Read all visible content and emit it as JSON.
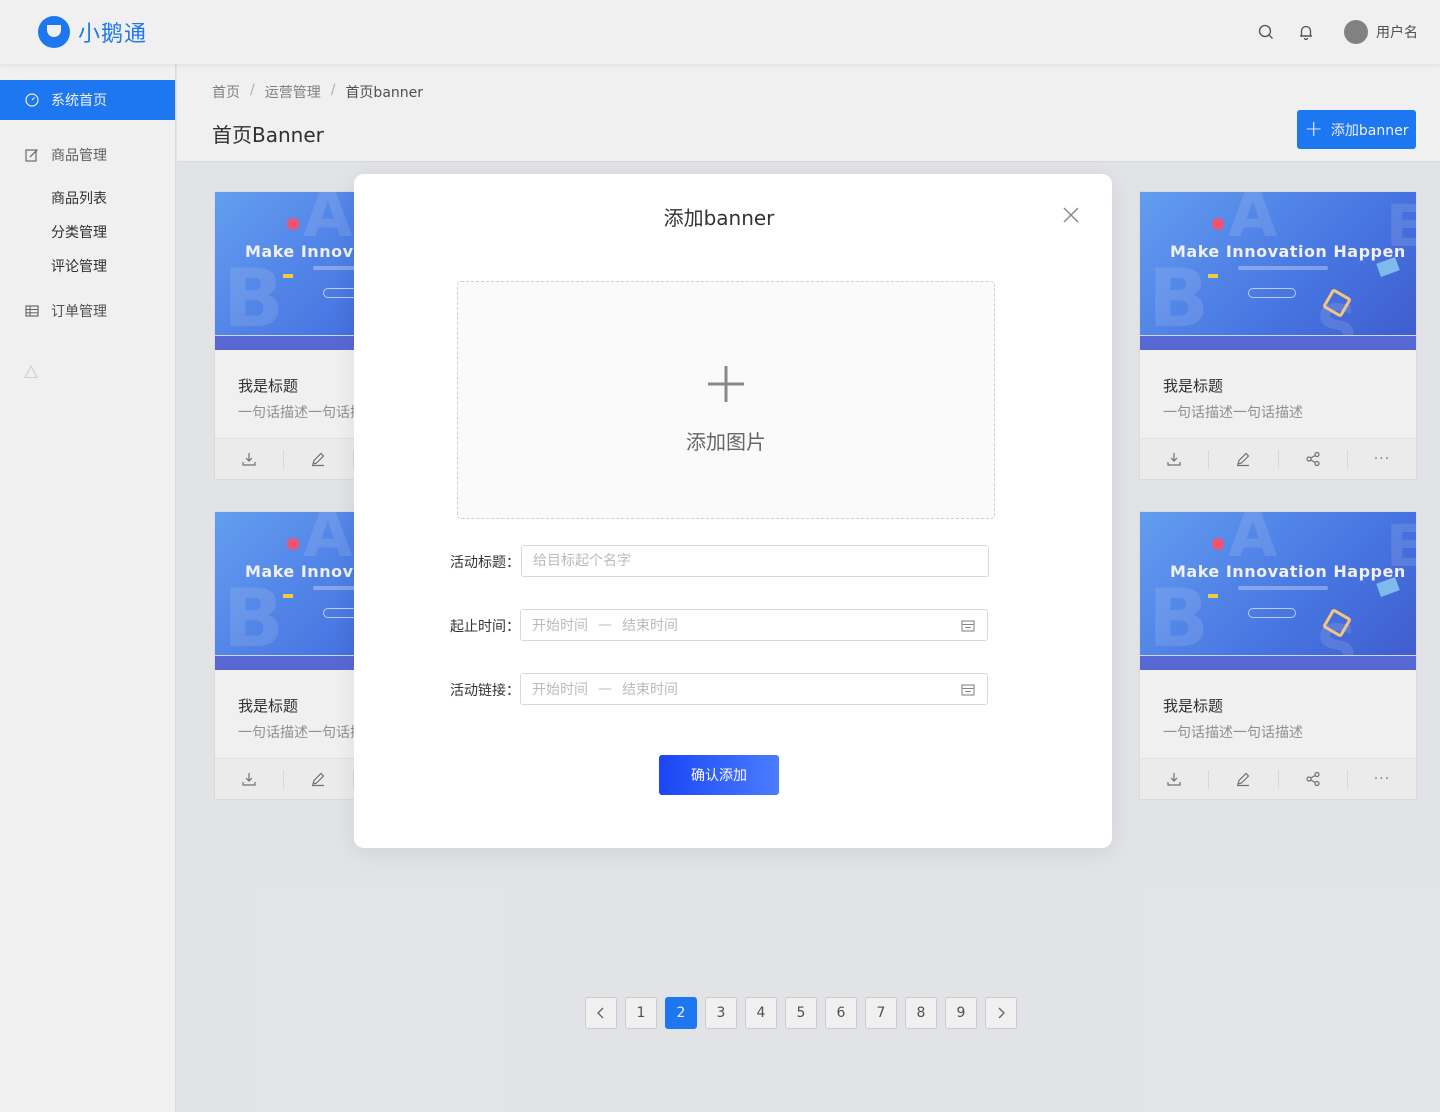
{
  "app": {
    "name": "小鹅通"
  },
  "header": {
    "username": "用户名"
  },
  "sidebar": {
    "items": [
      {
        "label": "系统首页"
      },
      {
        "label": "商品管理"
      },
      {
        "label": "订单管理"
      }
    ],
    "subitems": [
      {
        "label": "商品列表"
      },
      {
        "label": "分类管理"
      },
      {
        "label": "评论管理"
      }
    ]
  },
  "breadcrumb": [
    "首页",
    "运营管理",
    "首页banner"
  ],
  "page": {
    "title": "首页Banner",
    "add_button": "添加banner"
  },
  "cards": [
    {
      "headline": "Make Innovation Happen",
      "title": "我是标题",
      "desc": "一句话描述一句话描述"
    },
    {
      "headline": "Make Innovation Happen",
      "title": "我是标题",
      "desc": "一句话描述一句话描述"
    },
    {
      "headline": "Make Innovation Happen",
      "title": "我是标题",
      "desc": "一句话描述一句话描述"
    },
    {
      "headline": "Make Innovation Happen",
      "title": "我是标题",
      "desc": "一句话描述一句话描述"
    }
  ],
  "pagination": {
    "pages": [
      "1",
      "2",
      "3",
      "4",
      "5",
      "6",
      "7",
      "8",
      "9"
    ],
    "current": "2"
  },
  "modal": {
    "title": "添加banner",
    "upload_label": "添加图片",
    "fields": {
      "title_label": "活动标题：",
      "title_placeholder": "给目标起个名字",
      "time_label": "起止时间：",
      "link_label": "活动链接：",
      "start_placeholder": "开始时间",
      "end_placeholder": "结束时间",
      "range_sep": "—"
    },
    "confirm": "确认添加"
  },
  "colors": {
    "primary": "#1f7fff",
    "confirm_start": "#1a46f5",
    "confirm_end": "#4c7cff"
  }
}
